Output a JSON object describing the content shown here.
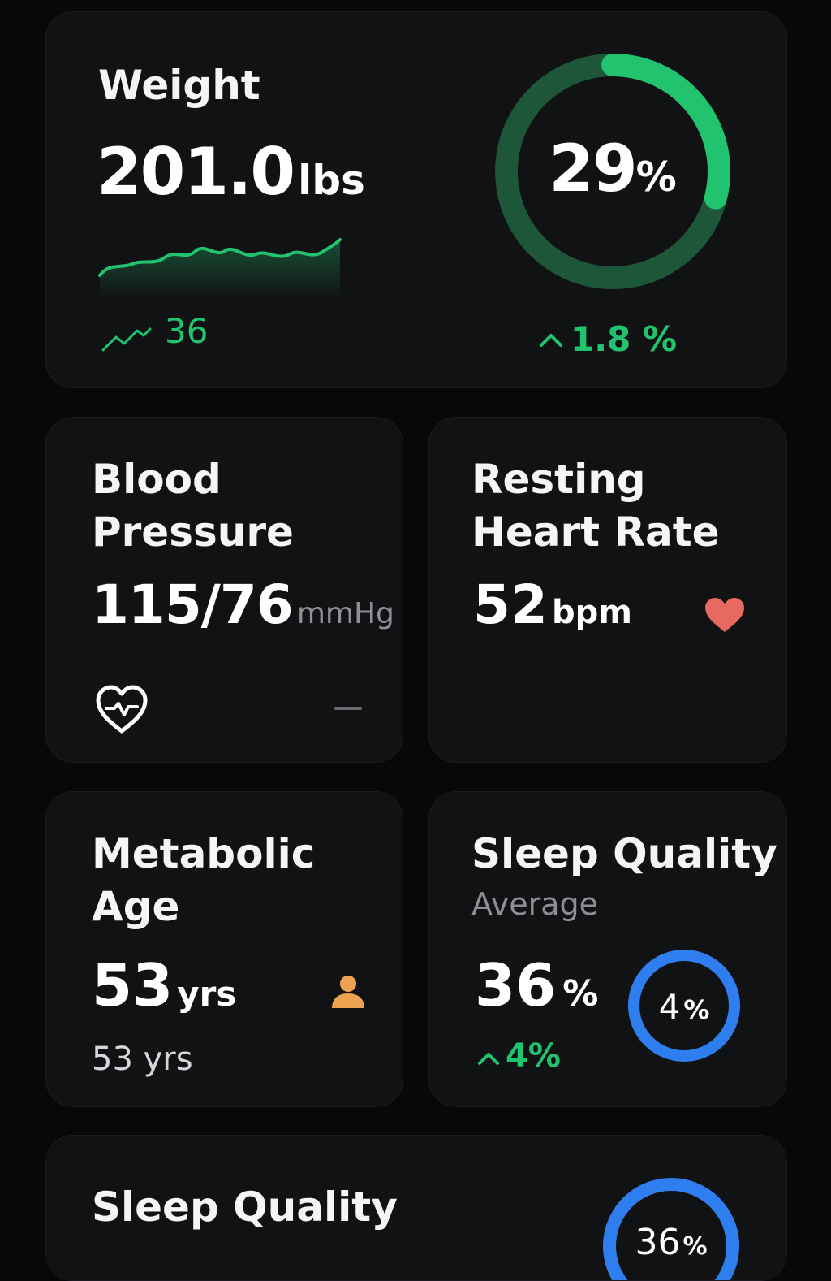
{
  "weight": {
    "title": "Weight",
    "value": "201.0",
    "unit": "lbs",
    "trend_value": "36",
    "ring_value": "29",
    "ring_unit": "%",
    "ring_fraction": 0.29,
    "change": "1.8 %",
    "accent": "#22c36f"
  },
  "blood_pressure": {
    "title_line1": "Blood",
    "title_line2": "Pressure",
    "value": "115/76",
    "unit": "mmHg",
    "icon": "heart-pulse-icon",
    "secondary_icon": "minus-icon"
  },
  "resting_heart_rate": {
    "title_line1": "Resting",
    "title_line2": "Heart Rate",
    "value": "52",
    "unit": "bpm",
    "icon": "heart-icon",
    "icon_color": "#e8695f"
  },
  "metabolic_age": {
    "title_line1": "Metabolic",
    "title_line2": "Age",
    "value": "53",
    "unit": "yrs",
    "secondary": "53 yrs",
    "icon": "person-icon",
    "icon_color": "#eda24f"
  },
  "sleep_quality": {
    "title": "Sleep Quality",
    "subtitle": "Average",
    "value": "36",
    "unit": "%",
    "change": "4%",
    "ring_value": "4",
    "ring_unit": "%",
    "accent": "#2f7ef0"
  },
  "sleep_quality_2": {
    "title": "Sleep Quality",
    "ring_value": "36",
    "ring_unit": "%",
    "accent": "#2f7ef0"
  }
}
